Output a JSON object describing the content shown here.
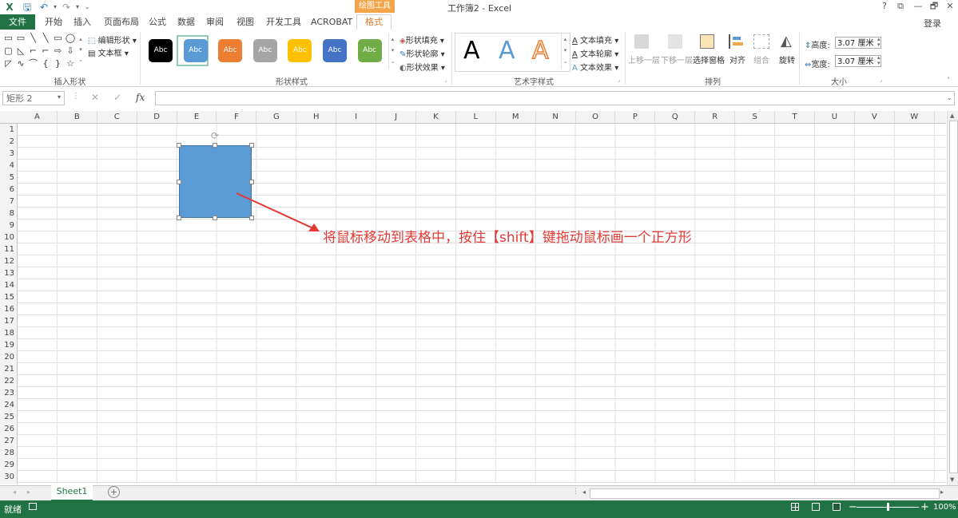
{
  "title_bar": {
    "contextual_label": "绘图工具",
    "window_title": "工作簿2 - Excel",
    "help": "?",
    "restore_ribbon": "⧉",
    "minimize": "—",
    "restore": "🗗",
    "close": "✕"
  },
  "tabs": {
    "file": "文件",
    "home": "开始",
    "insert": "插入",
    "page_layout": "页面布局",
    "formulas": "公式",
    "data": "数据",
    "review": "审阅",
    "view": "视图",
    "developer": "开发工具",
    "acrobat": "ACROBAT",
    "format": "格式",
    "signin": "登录"
  },
  "ribbon": {
    "insert_shapes": {
      "label": "插入形状",
      "edit_shape": "编辑形状",
      "text_box": "文本框",
      "shape_glyphs": [
        "▭",
        "▭",
        "╲",
        "╲",
        "▭",
        "◯",
        "▢",
        "◺",
        "⌐",
        "⌐",
        "⇨",
        "⇩",
        "◸",
        "∿",
        "⌒",
        "{",
        "}",
        "☆"
      ]
    },
    "shape_styles": {
      "label": "形状样式",
      "preset_text": "Abc",
      "preset_colors": [
        "#000000",
        "#5b9bd5",
        "#ed7d31",
        "#a5a5a5",
        "#ffc000",
        "#4472c4",
        "#70ad47"
      ],
      "fill": "形状填充",
      "outline": "形状轮廓",
      "effects": "形状效果"
    },
    "wordart_styles": {
      "label": "艺术字样式",
      "letter": "A",
      "text_fill": "文本填充",
      "text_outline": "文本轮廓",
      "text_effects": "文本效果"
    },
    "arrange": {
      "label": "排列",
      "bring_forward": "上移一层",
      "send_backward": "下移一层",
      "selection_pane": "选择窗格",
      "align": "对齐",
      "group": "组合",
      "rotate": "旋转"
    },
    "size": {
      "label": "大小",
      "height_label": "高度:",
      "height_value": "3.07 厘米",
      "width_label": "宽度:",
      "width_value": "3.07 厘米"
    }
  },
  "formula_bar": {
    "name_box": "矩形 2",
    "fx": "fx",
    "cancel": "✕",
    "enter": "✓"
  },
  "grid": {
    "columns": [
      "A",
      "B",
      "C",
      "D",
      "E",
      "F",
      "G",
      "H",
      "I",
      "J",
      "K",
      "L",
      "M",
      "N",
      "O",
      "P",
      "Q",
      "R",
      "S",
      "T",
      "U",
      "V",
      "W"
    ],
    "rows": [
      "1",
      "2",
      "3",
      "4",
      "5",
      "6",
      "7",
      "8",
      "9",
      "10",
      "11",
      "12",
      "13",
      "14",
      "15",
      "16",
      "17",
      "18",
      "19",
      "20",
      "21",
      "22",
      "23",
      "24",
      "25",
      "26",
      "27",
      "28",
      "29",
      "30"
    ]
  },
  "annotation": {
    "text": "将鼠标移动到表格中，按住【shift】键拖动鼠标画一个正方形"
  },
  "sheets": {
    "active": "Sheet1",
    "add": "+"
  },
  "status_bar": {
    "ready": "就绪",
    "zoom": "100%",
    "zoom_minus": "−",
    "zoom_plus": "+",
    "zoom_level": 0.5
  },
  "colors": {
    "accent": "#217346",
    "shape_fill": "#5b9bd5",
    "annotation": "#e53935",
    "contextual": "#f4a54a"
  }
}
